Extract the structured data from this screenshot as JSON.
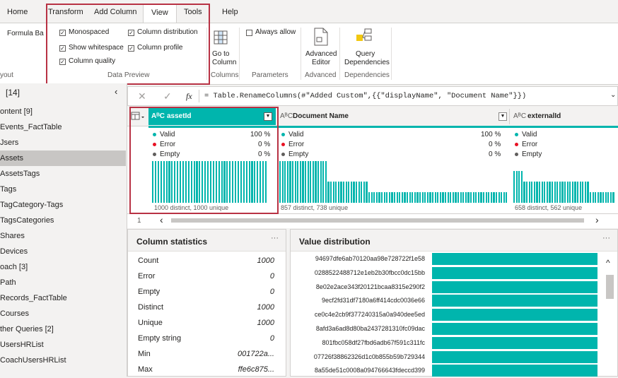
{
  "tabs": [
    "Home",
    "Transform",
    "Add Column",
    "View",
    "Tools",
    "Help"
  ],
  "ribbon": {
    "formula_bar_label": "Formula Ba",
    "layout_label": "yout",
    "monospaced": "Monospaced",
    "show_whitespace": "Show whitespace",
    "column_quality": "Column quality",
    "column_distribution": "Column distribution",
    "column_profile": "Column profile",
    "data_preview": "Data Preview",
    "go_to_column_1": "Go to",
    "go_to_column_2": "Column",
    "columns_label": "Columns",
    "always_allow": "Always allow",
    "parameters_label": "Parameters",
    "advanced_editor_1": "Advanced",
    "advanced_editor_2": "Editor",
    "advanced_label": "Advanced",
    "query_deps_1": "Query",
    "query_deps_2": "Dependencies",
    "dependencies_label": "Dependencies"
  },
  "nav": {
    "header": "[14]",
    "items": [
      "ontent [9]",
      "Events_FactTable",
      "Jsers",
      "Assets",
      "AssetsTags",
      "Tags",
      "TagCategory-Tags",
      "TagsCategories",
      "Shares",
      "Devices",
      "oach [3]",
      "Path",
      "Records_FactTable",
      "Courses",
      "ther Queries [2]",
      "UsersHRList",
      "CoachUsersHRList"
    ],
    "selected_index": 3
  },
  "formula": {
    "fx": "fx",
    "text": "= Table.RenameColumns(#\"Added Custom\",{{\"displayName\", \"Document Name\"}})"
  },
  "columns": [
    {
      "type": "AᴮC",
      "name": "assetId",
      "valid": "Valid",
      "valid_pct": "100 %",
      "error": "Error",
      "error_pct": "0 %",
      "empty": "Empty",
      "empty_pct": "0 %",
      "distinct": "1000 distinct, 1000 unique"
    },
    {
      "type": "AᴮC",
      "name": "Document Name",
      "valid": "Valid",
      "valid_pct": "100 %",
      "error": "Error",
      "error_pct": "0 %",
      "empty": "Empty",
      "empty_pct": "0 %",
      "distinct": "857 distinct, 738 unique"
    },
    {
      "type": "AᴮC",
      "name": "externalId",
      "valid": "Valid",
      "error": "Error",
      "empty": "Empty",
      "distinct": "658 distinct, 562 unique"
    }
  ],
  "row_number": "1",
  "column_statistics": {
    "title": "Column statistics",
    "more": "···",
    "rows": [
      {
        "k": "Count",
        "v": "1000"
      },
      {
        "k": "Error",
        "v": "0"
      },
      {
        "k": "Empty",
        "v": "0"
      },
      {
        "k": "Distinct",
        "v": "1000"
      },
      {
        "k": "Unique",
        "v": "1000"
      },
      {
        "k": "Empty string",
        "v": "0"
      },
      {
        "k": "Min",
        "v": "001722a..."
      },
      {
        "k": "Max",
        "v": "ffe6c875..."
      }
    ]
  },
  "value_distribution": {
    "title": "Value distribution",
    "more": "···",
    "values": [
      "94697dfe6ab70120aa98e728722f1e58",
      "0288522488712e1eb2b30fbcc0dc15bb",
      "8e02e2ace343f20121bcaa8315e290f2",
      "9ecf2fd31df7180a6ff414cdc0036e66",
      "ce0c4e2cb9f377240315a0a940dee5ed",
      "8afd3a6ad8d80ba2437281310fc09dac",
      "801fbc058df27fbd6adb67f591c311fc",
      "07726f38862326d1c0b855b59b729344",
      "8a55de51c0008a094766643fdeccd399"
    ]
  },
  "colors": {
    "accent": "#00b5ad",
    "highlight": "#b83244"
  }
}
